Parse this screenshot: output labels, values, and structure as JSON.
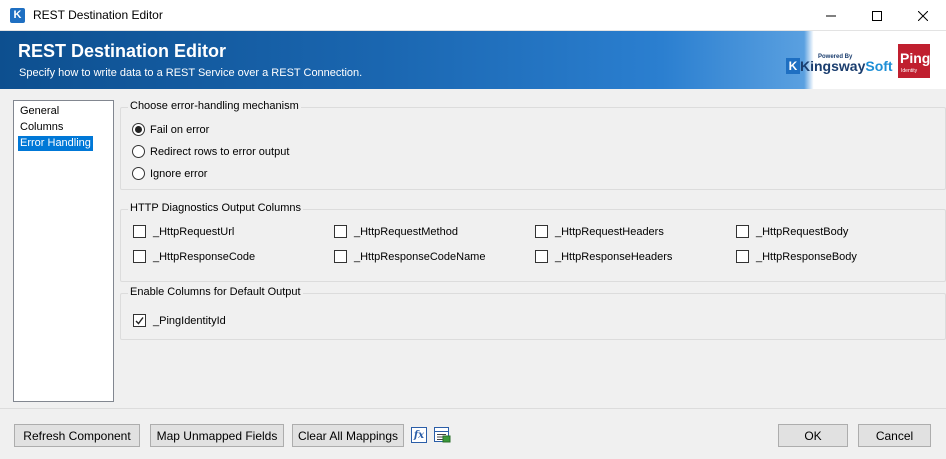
{
  "window": {
    "title": "REST Destination Editor",
    "icon": "kingswaysoft-k-icon",
    "controls": [
      "minimize-icon",
      "maximize-icon",
      "close-icon"
    ]
  },
  "banner": {
    "title": "REST Destination Editor",
    "subtitle": "Specify how to write data to a REST Service over a REST Connection.",
    "kingsway_logo": {
      "powered": "Powered By",
      "brand_a": "Kingsway",
      "brand_b": "Soft",
      "k": "K"
    },
    "ping_logo": {
      "word": "Ping",
      "sub": "Identity"
    }
  },
  "nav": {
    "items": [
      {
        "label": "General",
        "selected": false
      },
      {
        "label": "Columns",
        "selected": false
      },
      {
        "label": "Error Handling",
        "selected": true
      }
    ]
  },
  "error_handling": {
    "legend": "Choose error-handling mechanism",
    "options": [
      {
        "label": "Fail on error",
        "selected": true
      },
      {
        "label": "Redirect rows to error output",
        "selected": false
      },
      {
        "label": "Ignore error",
        "selected": false
      }
    ]
  },
  "diagnostics": {
    "legend": "HTTP Diagnostics Output Columns",
    "columns": [
      {
        "label": "_HttpRequestUrl",
        "checked": false
      },
      {
        "label": "_HttpRequestMethod",
        "checked": false
      },
      {
        "label": "_HttpRequestHeaders",
        "checked": false
      },
      {
        "label": "_HttpRequestBody",
        "checked": false
      },
      {
        "label": "_HttpResponseCode",
        "checked": false
      },
      {
        "label": "_HttpResponseCodeName",
        "checked": false
      },
      {
        "label": "_HttpResponseHeaders",
        "checked": false
      },
      {
        "label": "_HttpResponseBody",
        "checked": false
      }
    ]
  },
  "default_output": {
    "legend": "Enable Columns for Default Output",
    "columns": [
      {
        "label": "_PingIdentityId",
        "checked": true
      }
    ]
  },
  "footer": {
    "refresh": "Refresh Component",
    "map_unmapped": "Map Unmapped Fields",
    "clear_all": "Clear All Mappings",
    "fx": "fx",
    "ok": "OK",
    "cancel": "Cancel"
  }
}
